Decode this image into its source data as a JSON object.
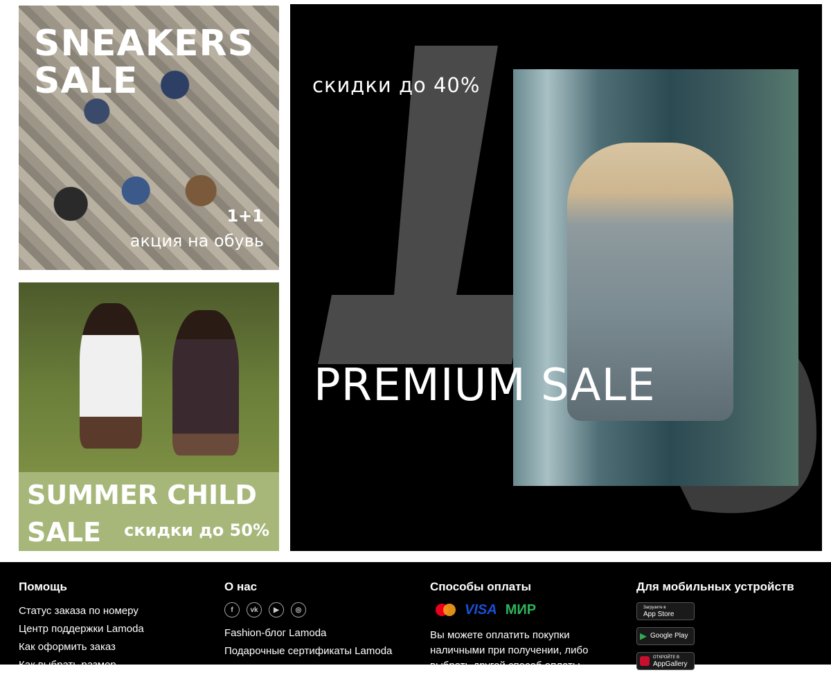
{
  "banners": {
    "sneakers": {
      "title_line1": "SNEAKERS",
      "title_line2": "SALE",
      "promo_big": "1+1",
      "promo_small": "акция на обувь"
    },
    "child": {
      "title_line1": "SUMMER CHILD",
      "title_line2": "SALE",
      "discount": "скидки до 50%"
    },
    "premium": {
      "discount": "скидки до 40%",
      "title": "PREMIUM SALE"
    }
  },
  "footer": {
    "help": {
      "heading": "Помощь",
      "links": [
        "Статус заказа по номеру",
        "Центр поддержки Lamoda",
        "Как оформить заказ",
        "Как выбрать размер"
      ]
    },
    "about": {
      "heading": "О нас",
      "social_icons": [
        "facebook-icon",
        "vk-icon",
        "youtube-icon",
        "instagram-icon"
      ],
      "links": [
        "Fashion-блог Lamoda",
        "Подарочные сертификаты Lamoda"
      ]
    },
    "payment": {
      "heading": "Способы оплаты",
      "methods": [
        "mastercard",
        "VISA",
        "МИР"
      ],
      "text": "Вы можете оплатить покупки наличными при получении, либо выбрать другой способ оплаты."
    },
    "mobile": {
      "heading": "Для мобильных устройств",
      "stores": [
        {
          "top": "Загрузите в",
          "name": "App Store"
        },
        {
          "top": "",
          "name": "Google Play"
        },
        {
          "top": "ОТКРОЙТЕ В",
          "name": "AppGallery"
        }
      ]
    }
  },
  "colors": {
    "footer_bg": "#000000",
    "child_band": "#a7b77a",
    "premium_bg": "#000000"
  }
}
